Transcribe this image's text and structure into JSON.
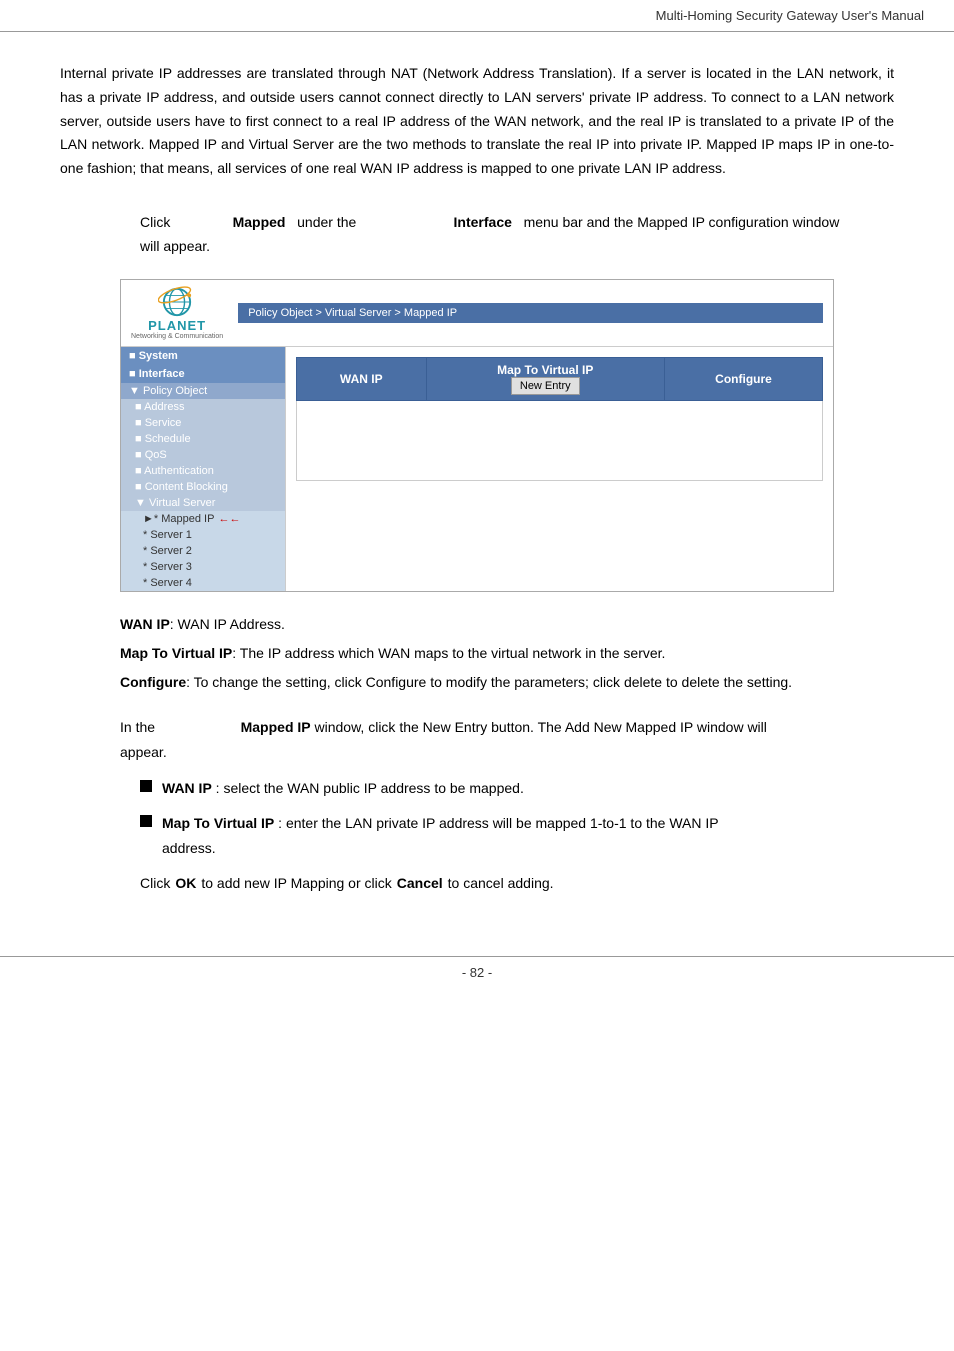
{
  "header": {
    "title": "Multi-Homing  Security  Gateway  User's  Manual"
  },
  "body_text": "Internal private IP addresses are translated through NAT (Network Address Translation). If a server is located in the LAN network, it has a private IP address, and outside users cannot connect directly to LAN servers' private IP address. To connect to a LAN network server, outside users have to first connect to a real IP address of the WAN network, and the real IP is translated to a private IP of the LAN network. Mapped IP and Virtual Server are the two methods to translate the real IP into private IP. Mapped IP maps IP in one-to-one fashion; that means, all services of one real WAN IP address is mapped to one private LAN IP address.",
  "click_instruction": {
    "part1": "Click",
    "keyword1": "Mapped",
    "part2": "under the",
    "keyword2": "Interface",
    "part3": "menu bar and the Mapped IP configuration window",
    "part4": "will appear."
  },
  "screenshot": {
    "breadcrumb": "Policy Object > Virtual Server > Mapped IP",
    "logo_text": "PLANET",
    "logo_subtext": "Networking & Communication",
    "table": {
      "columns": [
        "WAN IP",
        "Map To Virtual IP",
        "Configure"
      ],
      "new_entry_button": "New Entry"
    },
    "sidebar": {
      "items": [
        {
          "label": "System",
          "level": "section"
        },
        {
          "label": "Interface",
          "level": "section"
        },
        {
          "label": "Policy Object",
          "level": "sub-section"
        },
        {
          "label": "Address",
          "level": "sub-item"
        },
        {
          "label": "Service",
          "level": "sub-item"
        },
        {
          "label": "Schedule",
          "level": "sub-item"
        },
        {
          "label": "QoS",
          "level": "sub-item"
        },
        {
          "label": "Authentication",
          "level": "sub-item"
        },
        {
          "label": "Content Blocking",
          "level": "sub-item"
        },
        {
          "label": "Virtual Server",
          "level": "sub-item"
        },
        {
          "label": "* Mapped IP",
          "level": "sub-sub-item",
          "active": true,
          "arrow": true
        },
        {
          "label": "* Server 1",
          "level": "sub-sub-item"
        },
        {
          "label": "* Server 2",
          "level": "sub-sub-item"
        },
        {
          "label": "* Server 3",
          "level": "sub-sub-item"
        },
        {
          "label": "* Server 4",
          "level": "sub-sub-item"
        }
      ]
    }
  },
  "field_descriptions": [
    {
      "label": "WAN IP",
      "colon": ":",
      "desc": "WAN IP Address."
    },
    {
      "label": "Map To Virtual IP",
      "colon": ":",
      "desc": "The IP address which WAN maps to the virtual network in the server."
    },
    {
      "label": "Configure",
      "colon": ":",
      "desc": "To change the setting, click Configure to modify the parameters; click delete to delete the setting."
    }
  ],
  "window_section": {
    "intro": "In the",
    "keyword": "Mapped IP",
    "rest": "window, click the New Entry button. The Add New Mapped IP window will appear."
  },
  "bullets": [
    {
      "label": "WAN IP",
      "colon": ":",
      "text": "select the WAN public IP address to be mapped."
    },
    {
      "label": "Map To Virtual IP",
      "colon": ":",
      "text": "enter the LAN private IP address will be mapped 1-to-1 to the WAN IP address."
    }
  ],
  "click_row": {
    "part1": "Click",
    "keyword1": "OK",
    "part2": "to add new IP Mapping or click",
    "keyword2": "Cancel",
    "part3": "to cancel adding."
  },
  "footer": {
    "page_number": "- 82 -"
  }
}
